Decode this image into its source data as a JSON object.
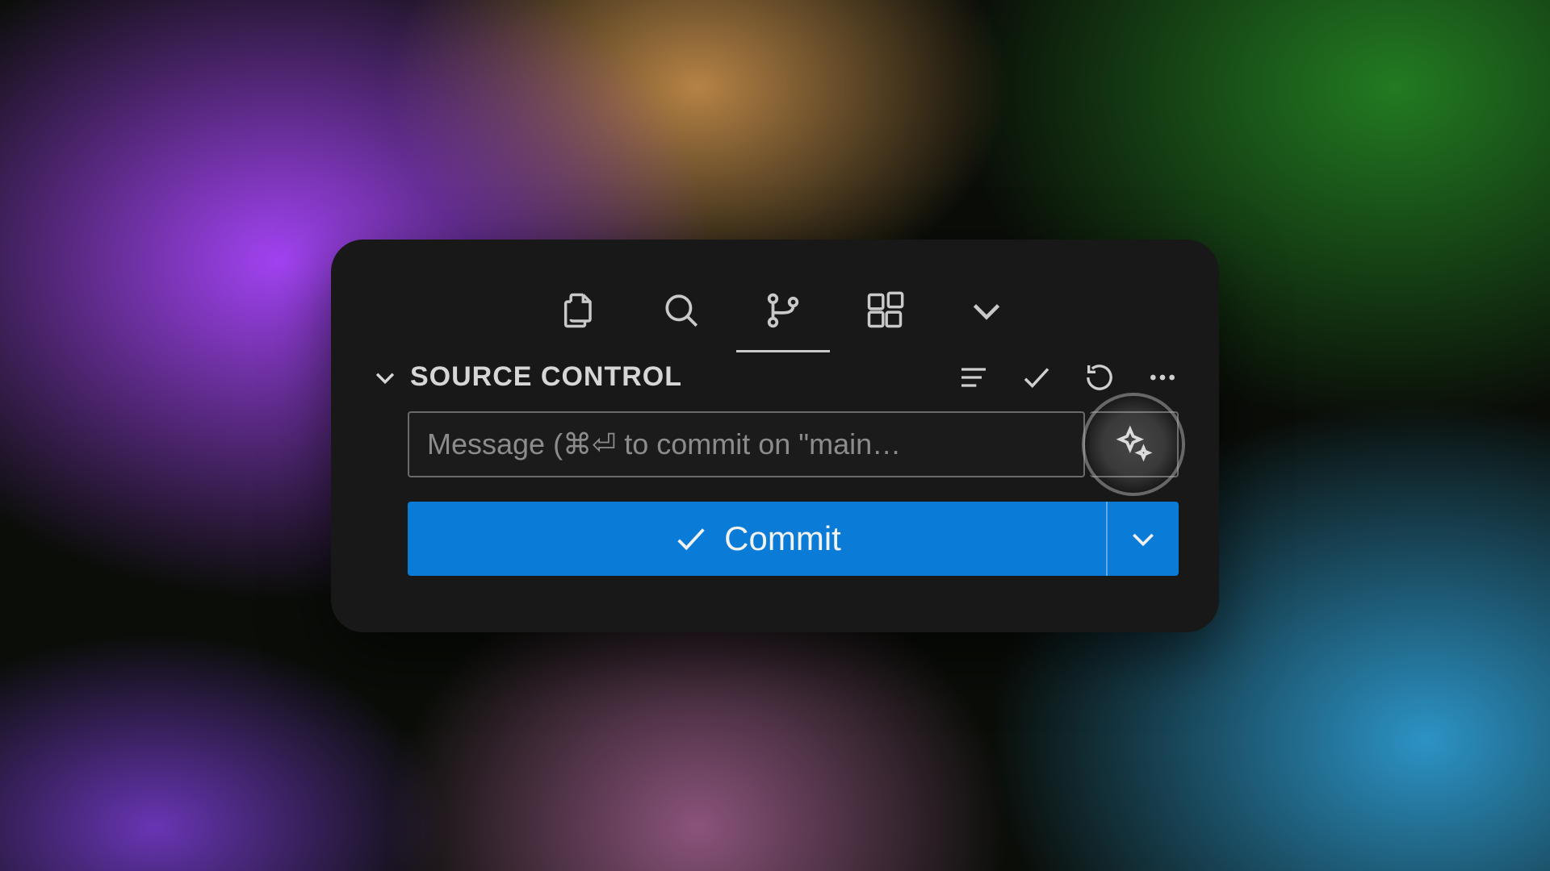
{
  "section": {
    "title": "SOURCE CONTROL"
  },
  "tabs": {
    "explorer": "Explorer",
    "search": "Search",
    "scm": "Source Control",
    "extensions": "Extensions",
    "overflow": "More"
  },
  "toolbar": {
    "view_tree": "View as Tree",
    "commit_action": "Commit",
    "refresh": "Refresh",
    "more": "More Actions"
  },
  "commit": {
    "message_placeholder": "Message (⌘⏎ to commit on \"main…",
    "ai_button": "Generate Commit Message",
    "button_label": "Commit",
    "dropdown": "Commit Options"
  },
  "colors": {
    "accent": "#0a7bd6",
    "panel": "#181818"
  }
}
